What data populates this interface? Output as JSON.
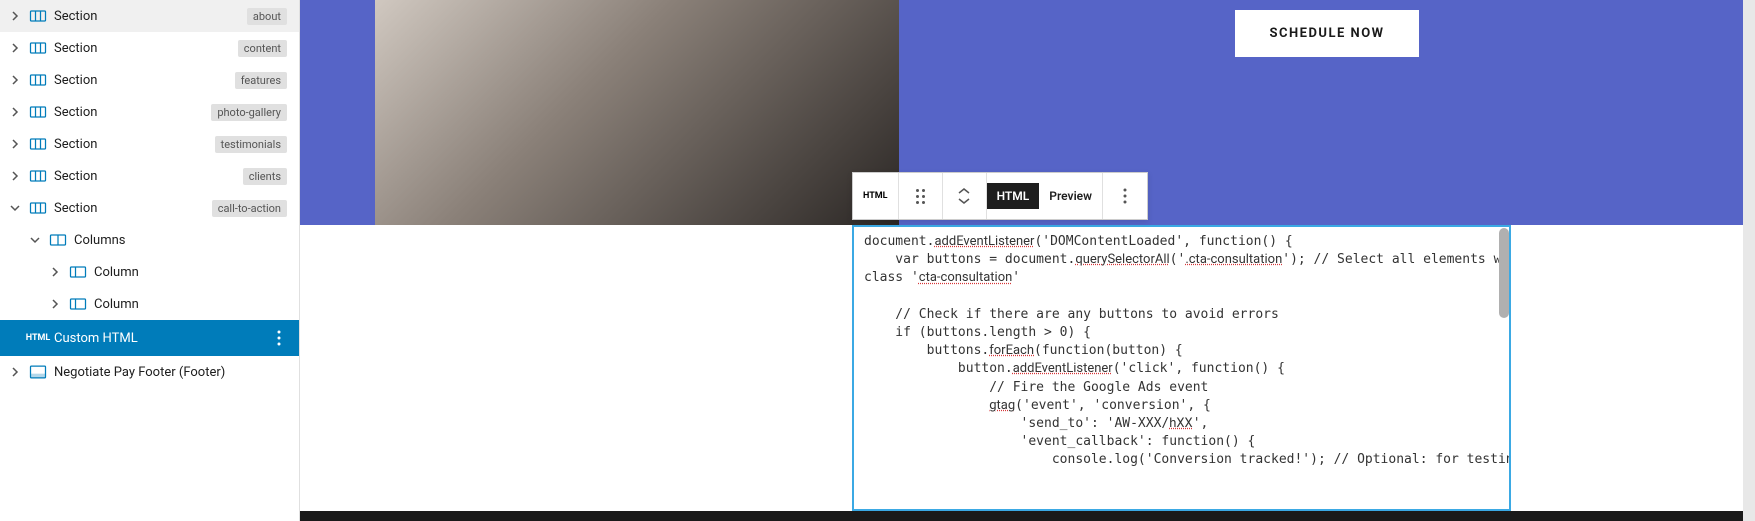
{
  "sidebar": {
    "items": [
      {
        "label": "Section",
        "tag": "about",
        "icon": "section",
        "chev": "right",
        "indent": 0
      },
      {
        "label": "Section",
        "tag": "content",
        "icon": "section",
        "chev": "right",
        "indent": 0
      },
      {
        "label": "Section",
        "tag": "features",
        "icon": "section",
        "chev": "right",
        "indent": 0
      },
      {
        "label": "Section",
        "tag": "photo-gallery",
        "icon": "section",
        "chev": "right",
        "indent": 0
      },
      {
        "label": "Section",
        "tag": "testimonials",
        "icon": "section",
        "chev": "right",
        "indent": 0
      },
      {
        "label": "Section",
        "tag": "clients",
        "icon": "section",
        "chev": "right",
        "indent": 0
      },
      {
        "label": "Section",
        "tag": "call-to-action",
        "icon": "section",
        "chev": "down",
        "indent": 0
      },
      {
        "label": "Columns",
        "tag": "",
        "icon": "columns",
        "chev": "down",
        "indent": 1
      },
      {
        "label": "Column",
        "tag": "",
        "icon": "column",
        "chev": "right",
        "indent": 2
      },
      {
        "label": "Column",
        "tag": "",
        "icon": "column",
        "chev": "right",
        "indent": 2
      },
      {
        "label": "Custom HTML",
        "tag": "",
        "icon": "html",
        "chev": "",
        "indent": 0,
        "selected": true
      },
      {
        "label": "Negotiate Pay Footer (Footer)",
        "tag": "",
        "icon": "footer",
        "chev": "right",
        "indent": 0
      }
    ]
  },
  "hero": {
    "cta_label": "SCHEDULE NOW"
  },
  "toolbar": {
    "type_label": "HTML",
    "tab_html": "HTML",
    "tab_preview": "Preview"
  },
  "code": {
    "lines": [
      {
        "plain": "document.",
        "u": "addEventListener",
        "rest": "('DOMContentLoaded', function() {"
      },
      {
        "plain": "    var buttons = document.",
        "u": "querySelectorAll",
        "rest": "('",
        "u2": ".cta-consultation",
        "rest2": "'); // Select all elements with the"
      },
      {
        "plain": "class '",
        "u": "cta-consultation",
        "rest": "'"
      },
      {
        "plain": ""
      },
      {
        "plain": "    // Check if there are any buttons to avoid errors"
      },
      {
        "plain": "    if (buttons.length > 0) {"
      },
      {
        "plain": "        buttons.",
        "u": "forEach",
        "rest": "(function(button) {"
      },
      {
        "plain": "            button.",
        "u": "addEventListener",
        "rest": "('click', function() {"
      },
      {
        "plain": "                // Fire the Google Ads event"
      },
      {
        "plain": "                ",
        "u": "gtag",
        "rest": "('event', 'conversion', {"
      },
      {
        "plain": "                    'send_to': 'AW-XXX/",
        "u": "hXX",
        "rest": "',"
      },
      {
        "plain": "                    'event_callback': function() {"
      },
      {
        "plain": "                        console.log('Conversion tracked!'); // Optional: for testing purposes"
      }
    ]
  }
}
